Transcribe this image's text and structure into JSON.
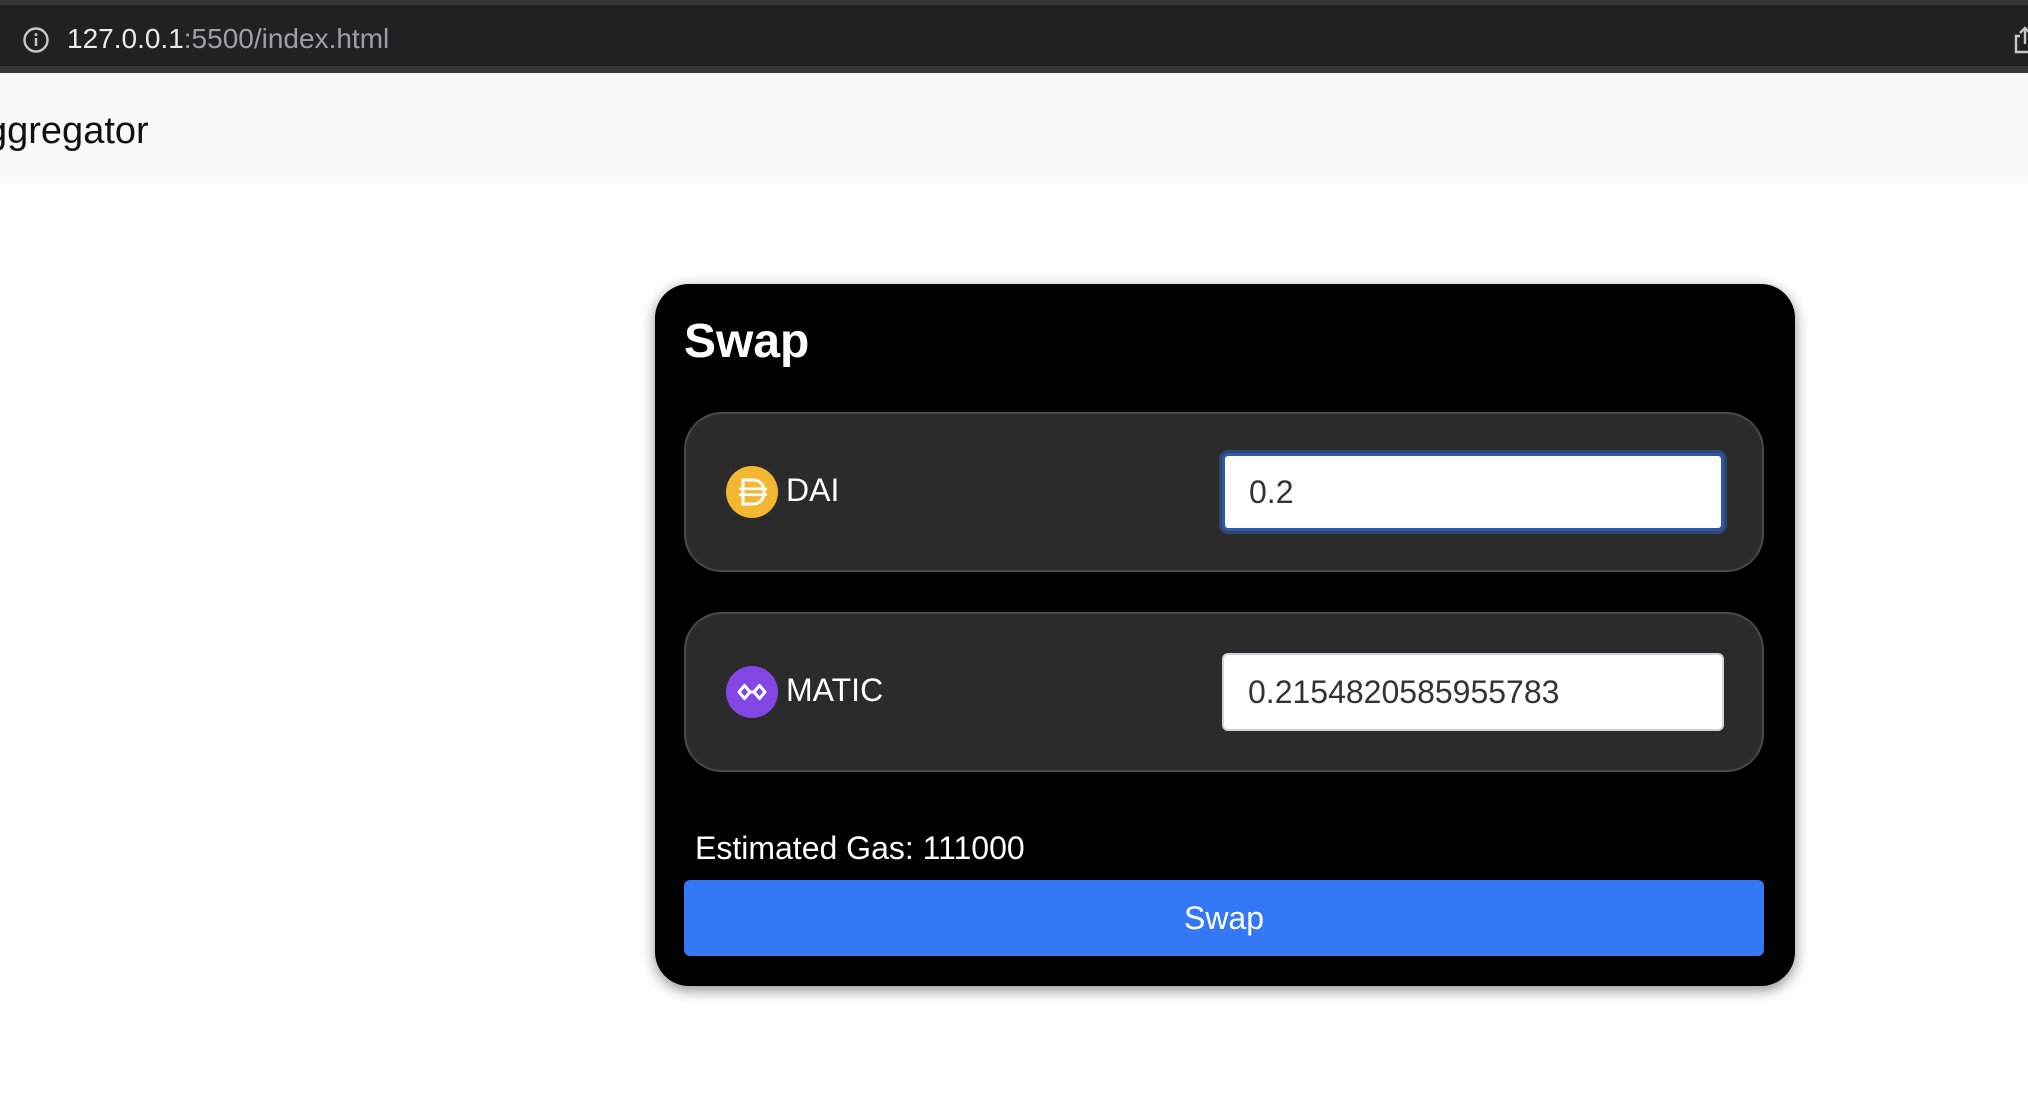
{
  "browser": {
    "url_host": "127.0.0.1",
    "url_rest": ":5500/index.html"
  },
  "navbar": {
    "brand": "ggregator"
  },
  "swap_card": {
    "title": "Swap",
    "from_token": {
      "symbol": "DAI",
      "amount": "0.2",
      "logo_icon": "dai-logo-icon",
      "logo_color": "#f4b731"
    },
    "to_token": {
      "symbol": "MATIC",
      "amount": "0.2154820585955783",
      "logo_icon": "matic-logo-icon",
      "logo_color": "#8247e5"
    },
    "estimated_gas_text": "Estimated Gas: 111000",
    "swap_button_label": "Swap",
    "button_color": "#3478f6"
  }
}
